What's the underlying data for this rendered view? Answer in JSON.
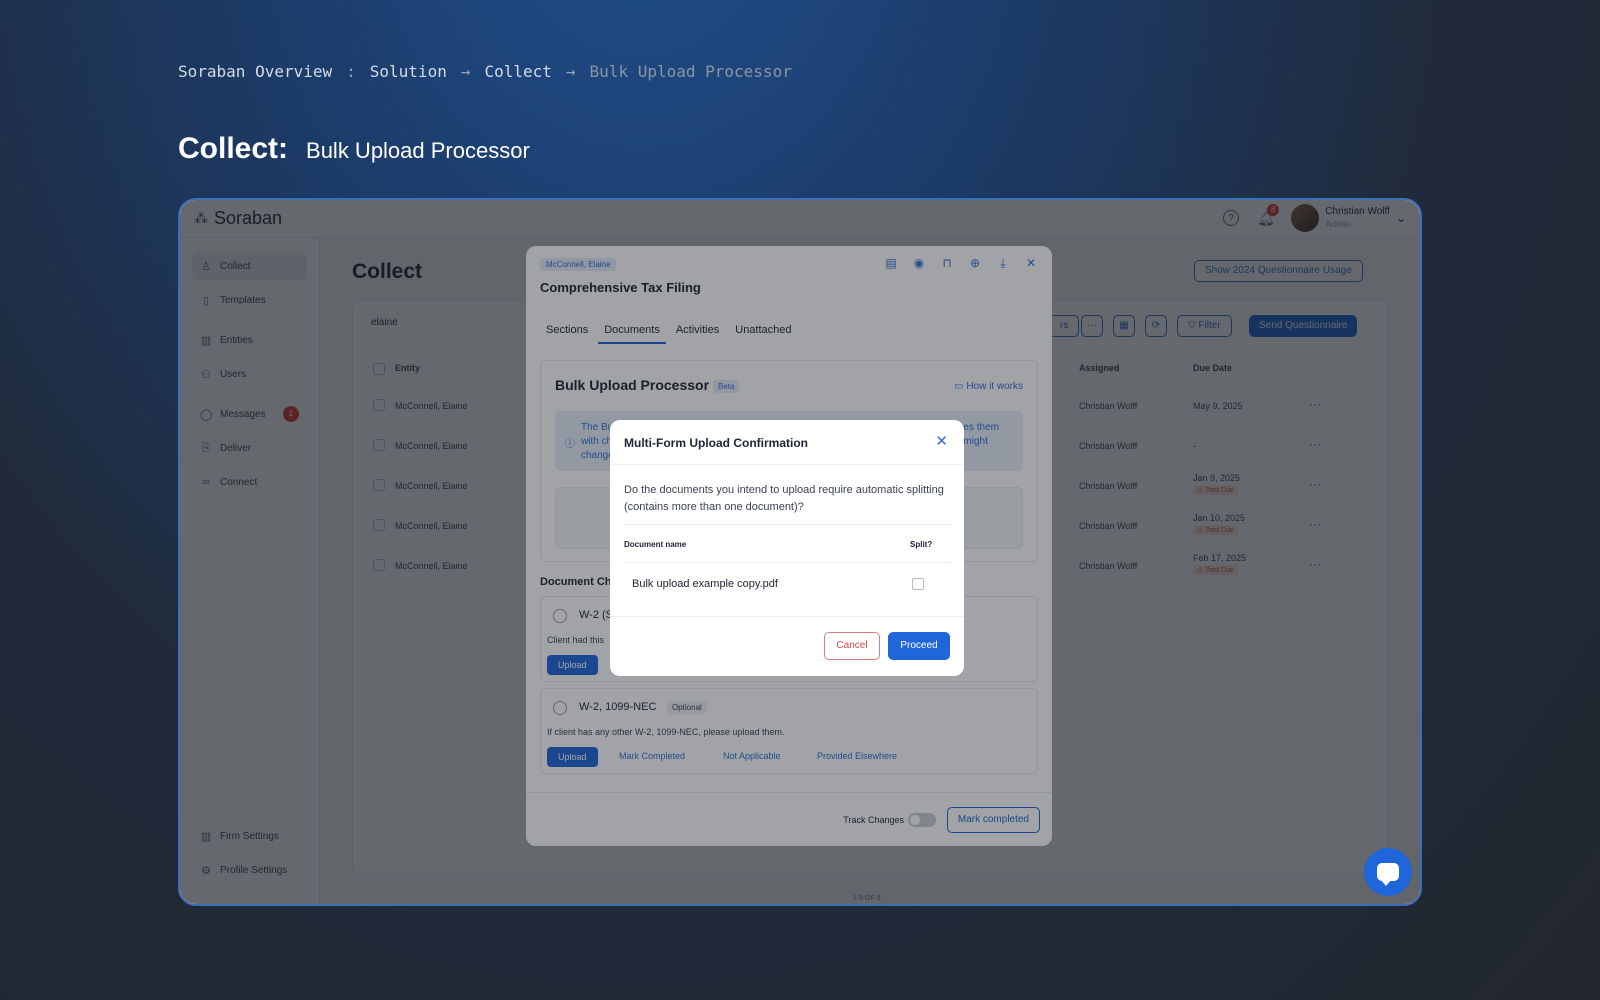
{
  "breadcrumb": {
    "root": "Soraban Overview",
    "sep1": ":",
    "item1": "Solution",
    "arrow1": "→",
    "item2": "Collect",
    "arrow2": "→",
    "current": "Bulk Upload Processor"
  },
  "heading": {
    "strong": "Collect:",
    "light": "Bulk Upload Processor"
  },
  "app": {
    "logo": "Soraban",
    "notifications_count": "8",
    "user": {
      "name": "Christian Wolff",
      "role": "Admin"
    },
    "sidebar": {
      "items": [
        {
          "label": "Collect",
          "icon": "people-icon"
        },
        {
          "label": "Templates",
          "icon": "document-icon"
        },
        {
          "label": "Entities",
          "icon": "building-icon"
        },
        {
          "label": "Users",
          "icon": "users-icon"
        },
        {
          "label": "Messages",
          "icon": "chat-icon",
          "badge": "1"
        },
        {
          "label": "Deliver",
          "icon": "deliver-icon"
        },
        {
          "label": "Connect",
          "icon": "link-icon"
        }
      ],
      "bottom": [
        {
          "label": "Firm Settings",
          "icon": "building-icon"
        },
        {
          "label": "Profile Settings",
          "icon": "profile-gear-icon"
        }
      ]
    },
    "main": {
      "title": "Collect",
      "usage_button": "Show 2024 Questionnaire Usage",
      "search_value": "elaine",
      "filter_button": "Filter",
      "send_button": "Send Questionnaire",
      "partial_button": "rs",
      "columns": {
        "entity": "Entity",
        "assigned": "Assigned",
        "due": "Due Date"
      },
      "rows": [
        {
          "entity": "McConnell, Elaine",
          "assigned": "Christian Wolff",
          "due": "May 9, 2025",
          "past_due": ""
        },
        {
          "entity": "McConnell, Elaine",
          "assigned": "Christian Wolff",
          "due": "-",
          "past_due": ""
        },
        {
          "entity": "McConnell, Elaine",
          "assigned": "Christian Wolff",
          "due": "Jan 9, 2025",
          "past_due": "Past Due"
        },
        {
          "entity": "McConnell, Elaine",
          "assigned": "Christian Wolff",
          "due": "Jan 10, 2025",
          "past_due": "Past Due"
        },
        {
          "entity": "McConnell, Elaine",
          "assigned": "Christian Wolff",
          "due": "Feb 17, 2025",
          "past_due": "Past Due"
        }
      ],
      "pager": "1-5 OF 5"
    },
    "drawer": {
      "tag": "McConnell, Elaine",
      "title": "Comprehensive Tax Filing",
      "tabs": [
        "Sections",
        "Documents",
        "Activities",
        "Unattached"
      ],
      "active_tab": "Documents",
      "bulk": {
        "title": "Bulk Upload Processor",
        "badge": "Beta",
        "how_link": "How it works",
        "info_left": [
          "The Bu",
          "with ch",
          "change"
        ],
        "info_right": [
          "es them",
          "might"
        ]
      },
      "checklist_title": "Document Ch",
      "item1": {
        "name": "W-2 (S",
        "desc": "Client had this",
        "upload": "Upload"
      },
      "item2": {
        "name": "W-2, 1099-NEC",
        "tag": "Optional",
        "desc": "If client has any other W-2, 1099-NEC, please upload them.",
        "upload": "Upload",
        "mark_completed": "Mark Completed",
        "not_applicable": "Not Applicable",
        "provided_elsewhere": "Provided Elsewhere"
      },
      "footer": {
        "track_changes": "Track Changes",
        "mark_completed": "Mark completed"
      }
    },
    "modal": {
      "title": "Multi-Form Upload Confirmation",
      "question": "Do the documents you intend to upload require automatic splitting (contains more than one document)?",
      "col_name": "Document name",
      "col_split": "Split?",
      "file": "Bulk upload example copy.pdf",
      "cancel": "Cancel",
      "proceed": "Proceed"
    }
  }
}
